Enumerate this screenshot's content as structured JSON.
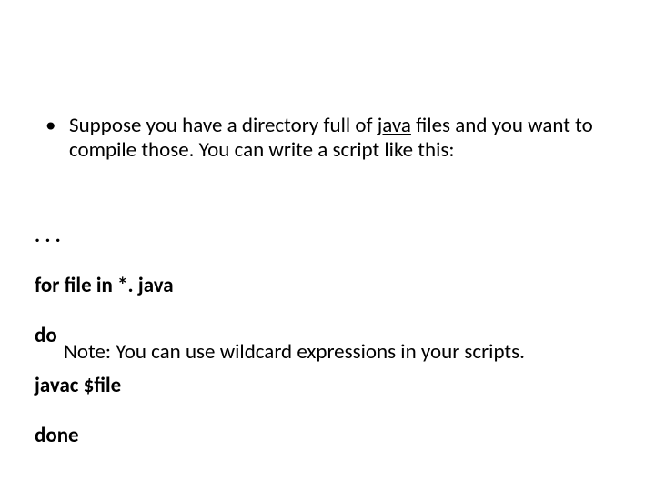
{
  "bullet": {
    "pre": "Suppose you have a directory full of ",
    "underlined": "java",
    "post": " files and you want to compile those. You can write a script like this:"
  },
  "code": {
    "l1": ". . .",
    "l2": "for file in *. java",
    "l3": "do",
    "l4": "javac $file",
    "l5": "done"
  },
  "note": "Note: You can use wildcard expressions in your scripts."
}
